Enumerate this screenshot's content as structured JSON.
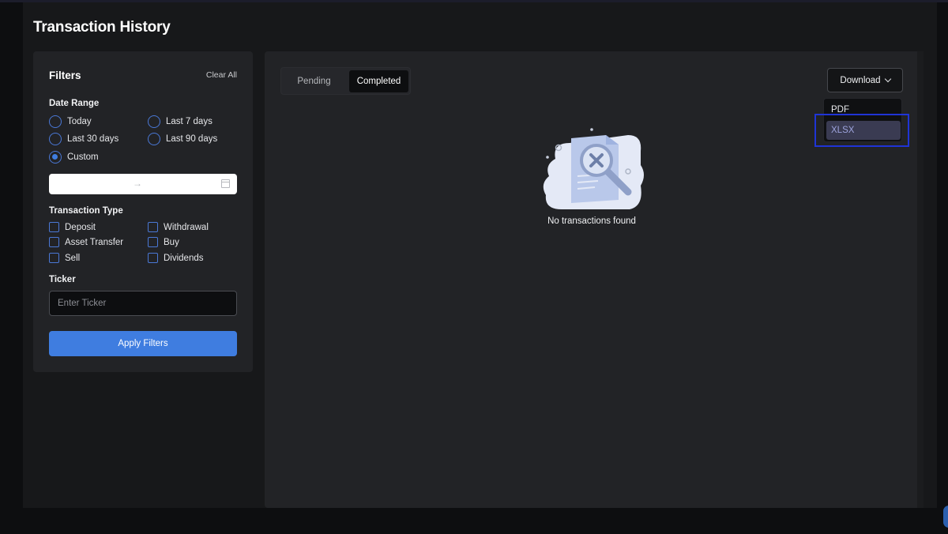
{
  "page": {
    "title": "Transaction History"
  },
  "filters": {
    "title": "Filters",
    "clear_all": "Clear All",
    "date_range": {
      "label": "Date Range",
      "options": [
        "Today",
        "Last 7 days",
        "Last 30 days",
        "Last 90 days",
        "Custom"
      ],
      "selected": "Custom"
    },
    "date_picker": {
      "separator": "→"
    },
    "transaction_type": {
      "label": "Transaction Type",
      "options": [
        "Deposit",
        "Withdrawal",
        "Asset Transfer",
        "Buy",
        "Sell",
        "Dividends"
      ]
    },
    "ticker": {
      "label": "Ticker",
      "placeholder": "Enter Ticker"
    },
    "apply_button": "Apply Filters"
  },
  "main": {
    "tabs": [
      {
        "label": "Pending",
        "active": false
      },
      {
        "label": "Completed",
        "active": true
      }
    ],
    "download": {
      "label": "Download",
      "options": [
        "PDF",
        "XLSX"
      ],
      "highlighted": "XLSX"
    },
    "empty_state": {
      "message": "No transactions found"
    }
  },
  "colors": {
    "accent": "#3f7de0",
    "panel": "#222326",
    "background": "#17181a",
    "highlight_box": "#1f34d6"
  }
}
